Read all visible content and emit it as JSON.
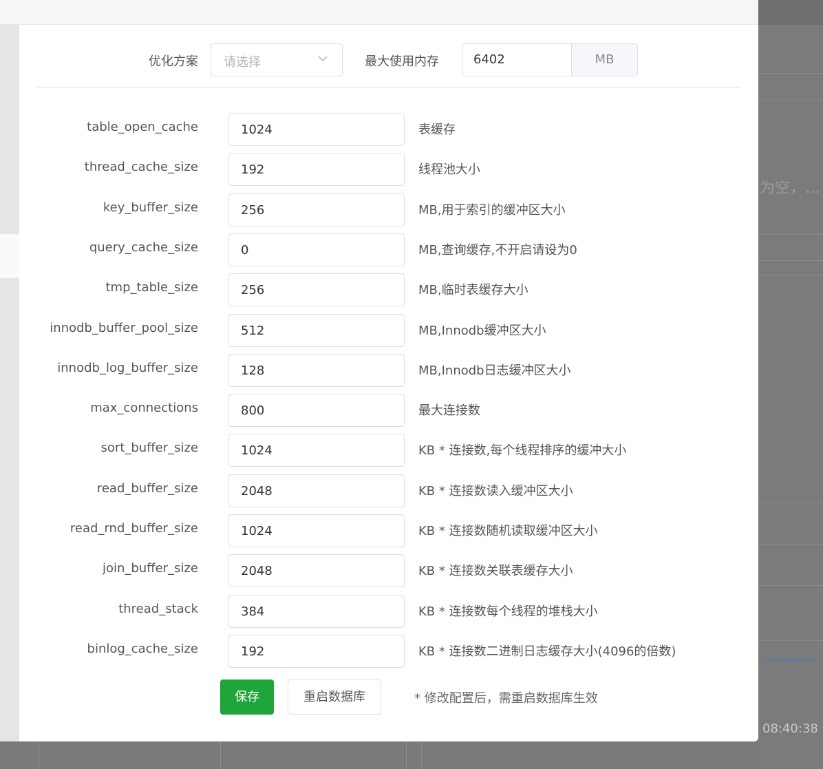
{
  "background": {
    "truncated_text": "为空，…",
    "chart_time": "08:40:38"
  },
  "top": {
    "plan_label": "优化方案",
    "plan_placeholder": "请选择",
    "memory_label": "最大使用内存",
    "memory_value": "6402",
    "memory_unit": "MB"
  },
  "params": [
    {
      "name": "table_open_cache",
      "value": "1024",
      "desc": "表缓存"
    },
    {
      "name": "thread_cache_size",
      "value": "192",
      "desc": "线程池大小"
    },
    {
      "name": "key_buffer_size",
      "value": "256",
      "desc": "MB,用于索引的缓冲区大小"
    },
    {
      "name": "query_cache_size",
      "value": "0",
      "desc": "MB,查询缓存,不开启请设为0"
    },
    {
      "name": "tmp_table_size",
      "value": "256",
      "desc": "MB,临时表缓存大小"
    },
    {
      "name": "innodb_buffer_pool_size",
      "value": "512",
      "desc": "MB,Innodb缓冲区大小"
    },
    {
      "name": "innodb_log_buffer_size",
      "value": "128",
      "desc": "MB,Innodb日志缓冲区大小"
    },
    {
      "name": "max_connections",
      "value": "800",
      "desc": "最大连接数"
    },
    {
      "name": "sort_buffer_size",
      "value": "1024",
      "desc": "KB * 连接数,每个线程排序的缓冲大小"
    },
    {
      "name": "read_buffer_size",
      "value": "2048",
      "desc": "KB * 连接数读入缓冲区大小"
    },
    {
      "name": "read_rnd_buffer_size",
      "value": "1024",
      "desc": "KB * 连接数随机读取缓冲区大小"
    },
    {
      "name": "join_buffer_size",
      "value": "2048",
      "desc": "KB * 连接数关联表缓存大小"
    },
    {
      "name": "thread_stack",
      "value": "384",
      "desc": "KB * 连接数每个线程的堆栈大小"
    },
    {
      "name": "binlog_cache_size",
      "value": "192",
      "desc": "KB * 连接数二进制日志缓存大小(4096的倍数)"
    }
  ],
  "actions": {
    "save_label": "保存",
    "restart_label": "重启数据库",
    "note": "* 修改配置后，需重启数据库生效"
  },
  "colors": {
    "primary": "#20a53a",
    "border": "#dcdfe6"
  }
}
